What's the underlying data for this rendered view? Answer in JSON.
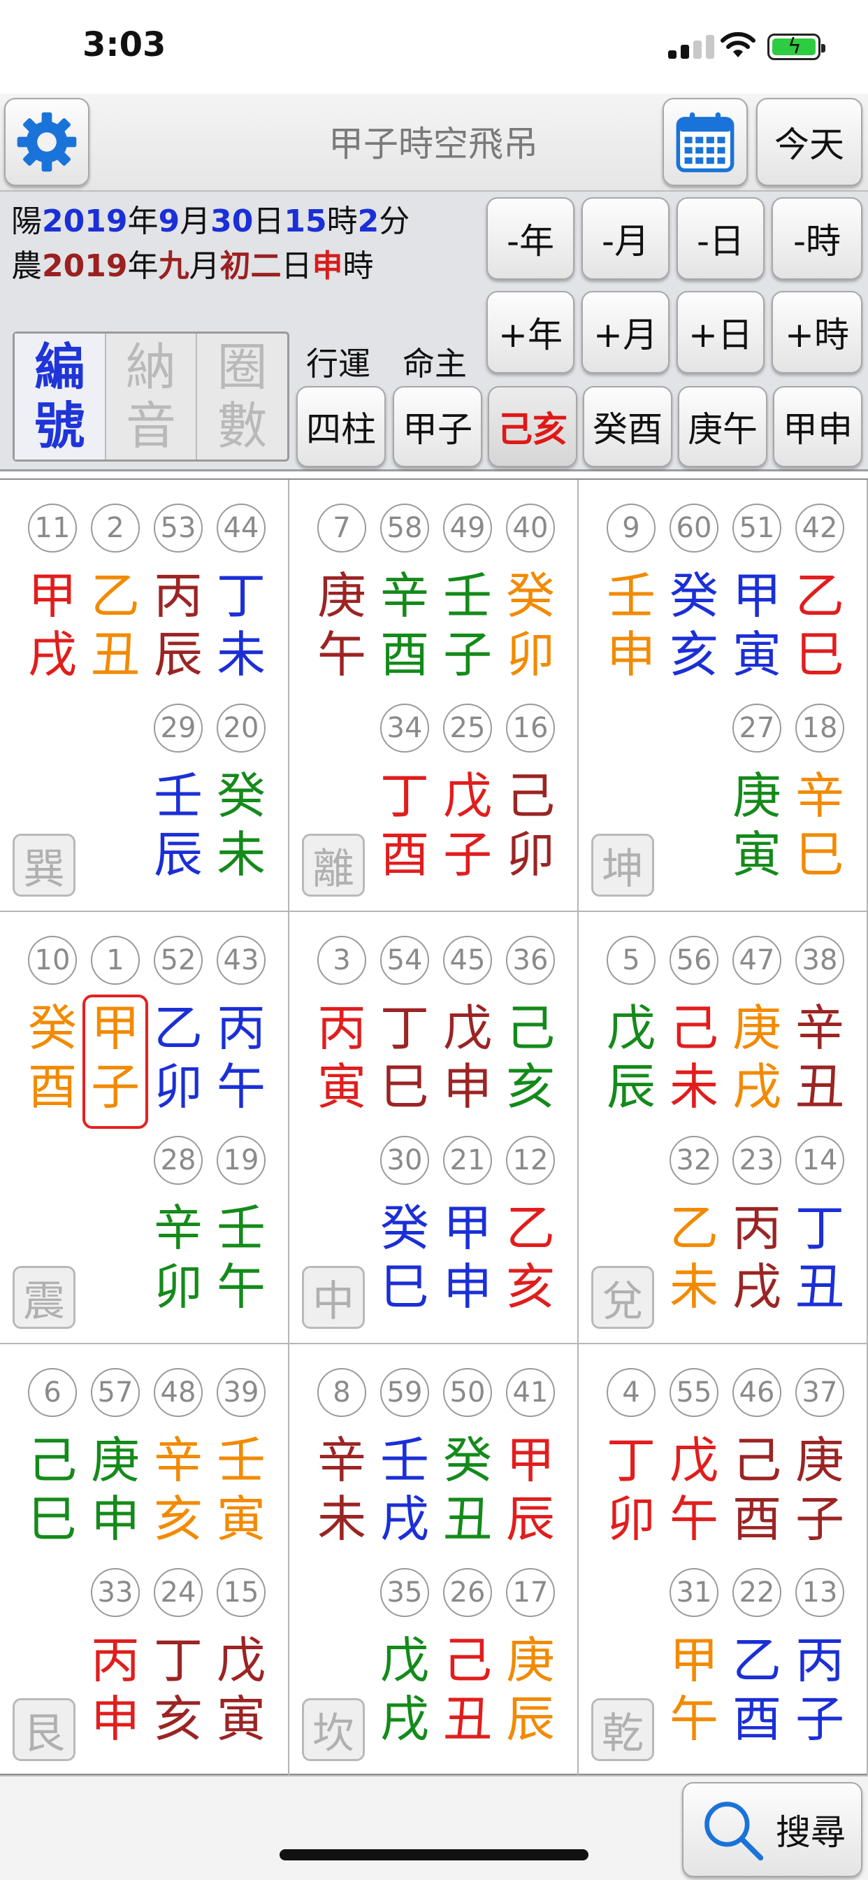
{
  "status_bar": {
    "time": "3:03"
  },
  "header": {
    "title": "甲子時空飛吊",
    "today_label": "今天",
    "icons": [
      "gear-icon",
      "calendar-icon"
    ]
  },
  "solar": {
    "prefix": "陽",
    "year": "2019",
    "year_unit": "年",
    "month": "9",
    "month_unit": "月",
    "day": "30",
    "day_unit": "日",
    "hour": "15",
    "hour_unit": "時",
    "minute": "2",
    "minute_unit": "分"
  },
  "lunar": {
    "prefix": "農",
    "year": "2019",
    "year_unit": "年",
    "month": "九",
    "month_unit": "月",
    "day": "初二",
    "day_unit": "日",
    "hour": "申",
    "hour_unit": "時"
  },
  "nav_buttons": {
    "minus": [
      "-年",
      "-月",
      "-日",
      "-時"
    ],
    "plus": [
      "+年",
      "+月",
      "+日",
      "+時"
    ]
  },
  "modes": [
    {
      "label_top": "編",
      "label_bottom": "號",
      "active": true
    },
    {
      "label_top": "納",
      "label_bottom": "音",
      "active": false
    },
    {
      "label_top": "圈",
      "label_bottom": "數",
      "active": false
    }
  ],
  "labels": {
    "xingyun": "行運",
    "mingzhu": "命主"
  },
  "pillars": [
    {
      "label": "四柱",
      "selected": false
    },
    {
      "label": "甲子",
      "selected": false
    },
    {
      "label": "己亥",
      "selected": true
    },
    {
      "label": "癸酉",
      "selected": false
    },
    {
      "label": "庚午",
      "selected": false
    },
    {
      "label": "甲申",
      "selected": false
    }
  ],
  "palaces": [
    {
      "trigram": "巽",
      "top": [
        {
          "num": "11",
          "gz": [
            "甲",
            "戌"
          ],
          "color": "#e11d1d"
        },
        {
          "num": "2",
          "gz": [
            "乙",
            "丑"
          ],
          "color": "#f28a00"
        },
        {
          "num": "53",
          "gz": [
            "丙",
            "辰"
          ],
          "color": "#9b2424"
        },
        {
          "num": "44",
          "gz": [
            "丁",
            "未"
          ],
          "color": "#1b2fd6"
        }
      ],
      "bottom": [
        {
          "num": "29",
          "gz": [
            "壬",
            "辰"
          ],
          "color": "#1b2fd6"
        },
        {
          "num": "20",
          "gz": [
            "癸",
            "未"
          ],
          "color": "#148a1a"
        }
      ]
    },
    {
      "trigram": "離",
      "top": [
        {
          "num": "7",
          "gz": [
            "庚",
            "午"
          ],
          "color": "#9b2424"
        },
        {
          "num": "58",
          "gz": [
            "辛",
            "酉"
          ],
          "color": "#148a1a"
        },
        {
          "num": "49",
          "gz": [
            "壬",
            "子"
          ],
          "color": "#148a1a"
        },
        {
          "num": "40",
          "gz": [
            "癸",
            "卯"
          ],
          "color": "#f28a00"
        }
      ],
      "bottom": [
        {
          "num": "34",
          "gz": [
            "丁",
            "酉"
          ],
          "color": "#e11d1d"
        },
        {
          "num": "25",
          "gz": [
            "戊",
            "子"
          ],
          "color": "#e11d1d"
        },
        {
          "num": "16",
          "gz": [
            "己",
            "卯"
          ],
          "color": "#9b2424"
        }
      ]
    },
    {
      "trigram": "坤",
      "top": [
        {
          "num": "9",
          "gz": [
            "壬",
            "申"
          ],
          "color": "#f28a00"
        },
        {
          "num": "60",
          "gz": [
            "癸",
            "亥"
          ],
          "color": "#1b2fd6"
        },
        {
          "num": "51",
          "gz": [
            "甲",
            "寅"
          ],
          "color": "#1b2fd6"
        },
        {
          "num": "42",
          "gz": [
            "乙",
            "巳"
          ],
          "color": "#e11d1d"
        }
      ],
      "bottom": [
        {
          "num": "27",
          "gz": [
            "庚",
            "寅"
          ],
          "color": "#148a1a"
        },
        {
          "num": "18",
          "gz": [
            "辛",
            "巳"
          ],
          "color": "#f28a00"
        }
      ]
    },
    {
      "trigram": "震",
      "top": [
        {
          "num": "10",
          "gz": [
            "癸",
            "酉"
          ],
          "color": "#f28a00"
        },
        {
          "num": "1",
          "gz": [
            "甲",
            "子"
          ],
          "color": "#f28a00",
          "highlight": true
        },
        {
          "num": "52",
          "gz": [
            "乙",
            "卯"
          ],
          "color": "#1b2fd6"
        },
        {
          "num": "43",
          "gz": [
            "丙",
            "午"
          ],
          "color": "#1b2fd6"
        }
      ],
      "bottom": [
        {
          "num": "28",
          "gz": [
            "辛",
            "卯"
          ],
          "color": "#148a1a"
        },
        {
          "num": "19",
          "gz": [
            "壬",
            "午"
          ],
          "color": "#148a1a"
        }
      ]
    },
    {
      "trigram": "中",
      "top": [
        {
          "num": "3",
          "gz": [
            "丙",
            "寅"
          ],
          "color": "#e11d1d"
        },
        {
          "num": "54",
          "gz": [
            "丁",
            "巳"
          ],
          "color": "#9b2424"
        },
        {
          "num": "45",
          "gz": [
            "戊",
            "申"
          ],
          "color": "#9b2424"
        },
        {
          "num": "36",
          "gz": [
            "己",
            "亥"
          ],
          "color": "#148a1a"
        }
      ],
      "bottom": [
        {
          "num": "30",
          "gz": [
            "癸",
            "巳"
          ],
          "color": "#1b2fd6"
        },
        {
          "num": "21",
          "gz": [
            "甲",
            "申"
          ],
          "color": "#1b2fd6"
        },
        {
          "num": "12",
          "gz": [
            "乙",
            "亥"
          ],
          "color": "#e11d1d"
        }
      ]
    },
    {
      "trigram": "兌",
      "top": [
        {
          "num": "5",
          "gz": [
            "戊",
            "辰"
          ],
          "color": "#148a1a"
        },
        {
          "num": "56",
          "gz": [
            "己",
            "未"
          ],
          "color": "#e11d1d"
        },
        {
          "num": "47",
          "gz": [
            "庚",
            "戌"
          ],
          "color": "#f28a00"
        },
        {
          "num": "38",
          "gz": [
            "辛",
            "丑"
          ],
          "color": "#9b2424"
        }
      ],
      "bottom": [
        {
          "num": "32",
          "gz": [
            "乙",
            "未"
          ],
          "color": "#f28a00"
        },
        {
          "num": "23",
          "gz": [
            "丙",
            "戌"
          ],
          "color": "#9b2424"
        },
        {
          "num": "14",
          "gz": [
            "丁",
            "丑"
          ],
          "color": "#1b2fd6"
        }
      ]
    },
    {
      "trigram": "艮",
      "top": [
        {
          "num": "6",
          "gz": [
            "己",
            "巳"
          ],
          "color": "#148a1a"
        },
        {
          "num": "57",
          "gz": [
            "庚",
            "申"
          ],
          "color": "#148a1a"
        },
        {
          "num": "48",
          "gz": [
            "辛",
            "亥"
          ],
          "color": "#f28a00"
        },
        {
          "num": "39",
          "gz": [
            "壬",
            "寅"
          ],
          "color": "#f28a00"
        }
      ],
      "bottom": [
        {
          "num": "33",
          "gz": [
            "丙",
            "申"
          ],
          "color": "#e11d1d"
        },
        {
          "num": "24",
          "gz": [
            "丁",
            "亥"
          ],
          "color": "#9b2424"
        },
        {
          "num": "15",
          "gz": [
            "戊",
            "寅"
          ],
          "color": "#9b2424"
        }
      ]
    },
    {
      "trigram": "坎",
      "top": [
        {
          "num": "8",
          "gz": [
            "辛",
            "未"
          ],
          "color": "#9b2424"
        },
        {
          "num": "59",
          "gz": [
            "壬",
            "戌"
          ],
          "color": "#1b2fd6"
        },
        {
          "num": "50",
          "gz": [
            "癸",
            "丑"
          ],
          "color": "#148a1a"
        },
        {
          "num": "41",
          "gz": [
            "甲",
            "辰"
          ],
          "color": "#e11d1d"
        }
      ],
      "bottom": [
        {
          "num": "35",
          "gz": [
            "戊",
            "戌"
          ],
          "color": "#148a1a"
        },
        {
          "num": "26",
          "gz": [
            "己",
            "丑"
          ],
          "color": "#e11d1d"
        },
        {
          "num": "17",
          "gz": [
            "庚",
            "辰"
          ],
          "color": "#f28a00"
        }
      ]
    },
    {
      "trigram": "乾",
      "top": [
        {
          "num": "4",
          "gz": [
            "丁",
            "卯"
          ],
          "color": "#e11d1d"
        },
        {
          "num": "55",
          "gz": [
            "戊",
            "午"
          ],
          "color": "#e11d1d"
        },
        {
          "num": "46",
          "gz": [
            "己",
            "酉"
          ],
          "color": "#9b2424"
        },
        {
          "num": "37",
          "gz": [
            "庚",
            "子"
          ],
          "color": "#9b2424"
        }
      ],
      "bottom": [
        {
          "num": "31",
          "gz": [
            "甲",
            "午"
          ],
          "color": "#f28a00"
        },
        {
          "num": "22",
          "gz": [
            "乙",
            "酉"
          ],
          "color": "#1b2fd6"
        },
        {
          "num": "13",
          "gz": [
            "丙",
            "子"
          ],
          "color": "#1b2fd6"
        }
      ]
    }
  ],
  "footer": {
    "search_label": "搜尋"
  }
}
